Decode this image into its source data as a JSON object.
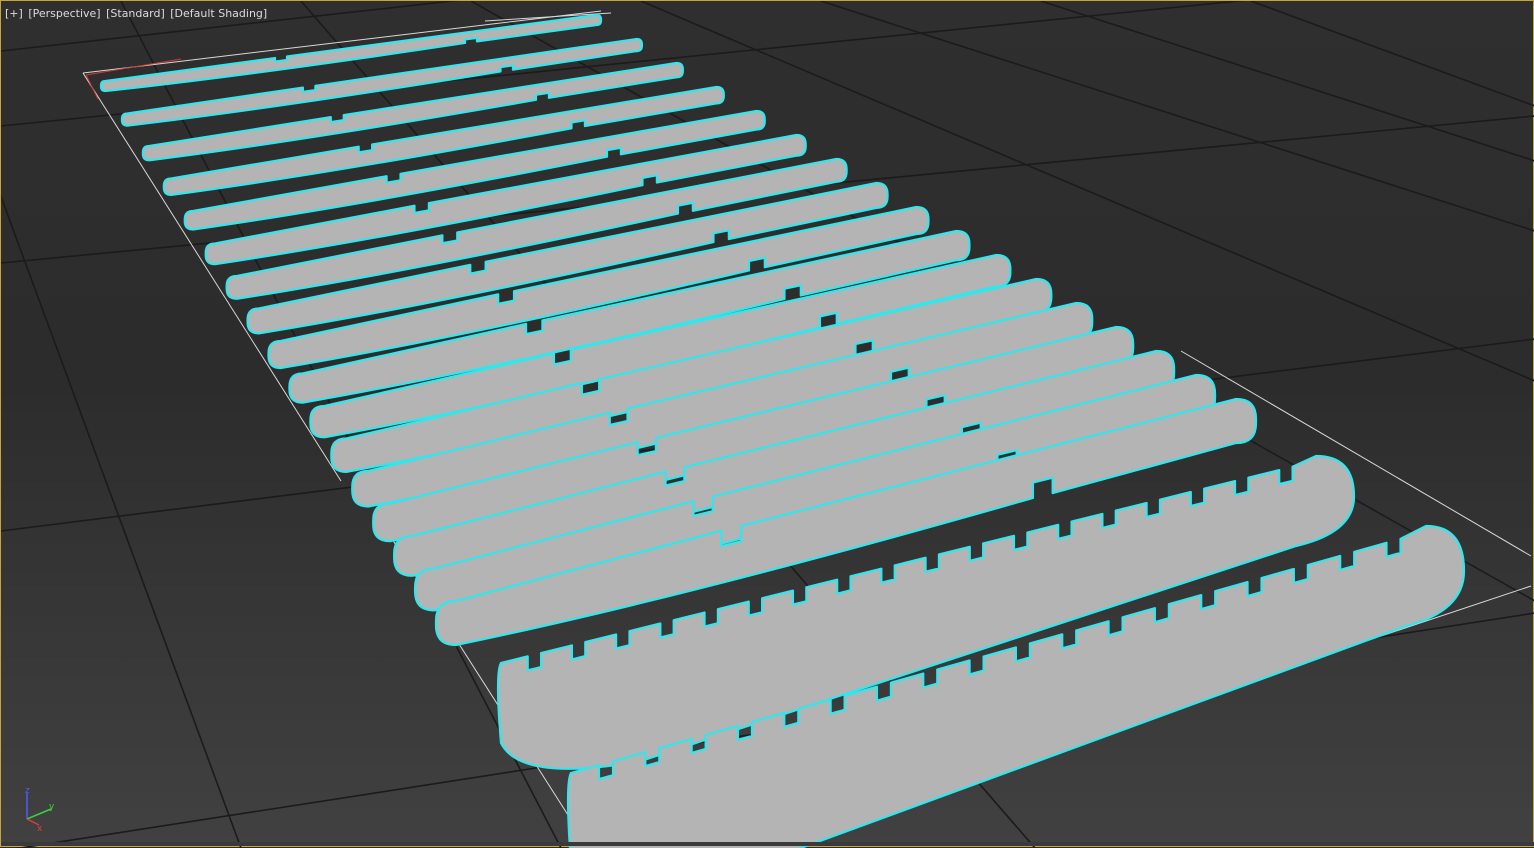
{
  "viewport": {
    "menu": [
      "[+]",
      "[Perspective]",
      "[Standard]",
      "[Default Shading]"
    ],
    "view": "Perspective",
    "style": "Standard",
    "shading": "Default Shading"
  },
  "axis_gizmo": {
    "labels": [
      "z",
      "y",
      "x"
    ]
  },
  "colors": {
    "selection": "#33e6ec",
    "surface": "#b4b4b4",
    "grid": "#1b1b1b",
    "border": "#c8a43a"
  },
  "scene": {
    "object_kind": "flat sliced rib panels",
    "rib_count": 17,
    "long_spine_count": 2,
    "spine_slot_count": 18
  }
}
